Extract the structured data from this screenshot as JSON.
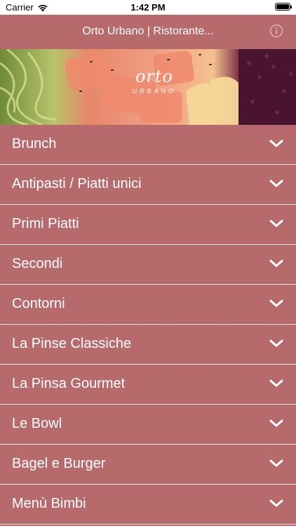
{
  "status_bar": {
    "carrier": "Carrier",
    "time": "1:42 PM"
  },
  "nav": {
    "title": "Orto Urbano | Ristorante...",
    "info_icon": "info-icon"
  },
  "banner": {
    "logo_main": "orto",
    "logo_sub": "URBANO"
  },
  "menu": {
    "items": [
      {
        "label": "Brunch"
      },
      {
        "label": "Antipasti / Piatti unici"
      },
      {
        "label": "Primi Piatti"
      },
      {
        "label": "Secondi"
      },
      {
        "label": "Contorni"
      },
      {
        "label": "La Pinse Classiche"
      },
      {
        "label": "La Pinsa Gourmet"
      },
      {
        "label": "Le Bowl"
      },
      {
        "label": "Bagel e Burger"
      },
      {
        "label": "Menù Bimbi"
      }
    ]
  },
  "colors": {
    "accent": "#b66a6b",
    "text": "#ffffff"
  }
}
